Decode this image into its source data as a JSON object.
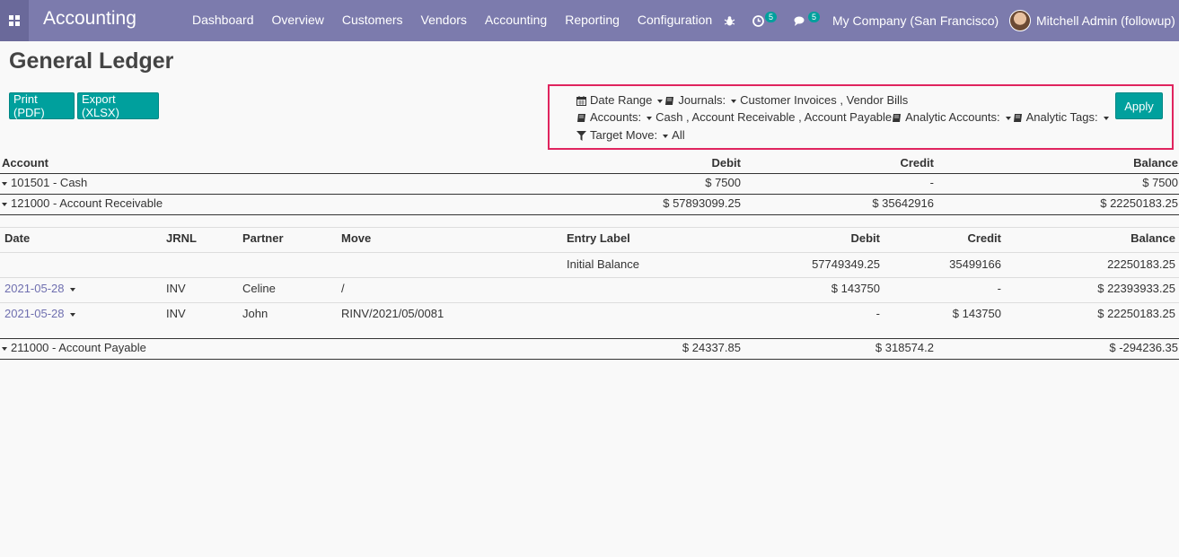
{
  "nav": {
    "app_name": "Accounting",
    "menu": [
      "Dashboard",
      "Overview",
      "Customers",
      "Vendors",
      "Accounting",
      "Reporting",
      "Configuration"
    ],
    "activity_count": "5",
    "message_count": "5",
    "company": "My Company (San Francisco)",
    "user": "Mitchell Admin (followup)"
  },
  "page": {
    "title": "General Ledger",
    "print_label": "Print (PDF)",
    "export_label": "Export (XLSX)",
    "apply_label": "Apply"
  },
  "filters": {
    "date_range_label": "Date Range",
    "journals_label": "Journals:",
    "journals_value": "Customer Invoices , Vendor Bills",
    "accounts_label": "Accounts:",
    "accounts_value": "Cash , Account Receivable , Account Payable",
    "analytic_accounts_label": "Analytic Accounts:",
    "analytic_tags_label": "Analytic Tags:",
    "target_move_label": "Target Move:",
    "target_move_value": "All"
  },
  "ledger": {
    "headers": {
      "account": "Account",
      "debit": "Debit",
      "credit": "Credit",
      "balance": "Balance"
    },
    "accounts": [
      {
        "name": "101501 - Cash",
        "debit": "$ 7500",
        "credit": "-",
        "balance": "$ 7500"
      },
      {
        "name": "121000 - Account Receivable",
        "debit": "$ 57893099.25",
        "credit": "$ 35642916",
        "balance": "$ 22250183.25"
      },
      {
        "name": "211000 - Account Payable",
        "debit": "$ 24337.85",
        "credit": "$ 318574.2",
        "balance": "$ -294236.35"
      }
    ],
    "detail_headers": {
      "date": "Date",
      "jrnl": "JRNL",
      "partner": "Partner",
      "move": "Move",
      "entry_label": "Entry Label",
      "debit": "Debit",
      "credit": "Credit",
      "balance": "Balance"
    },
    "initial": {
      "label": "Initial Balance",
      "debit": "57749349.25",
      "credit": "35499166",
      "balance": "22250183.25"
    },
    "lines": [
      {
        "date": "2021-05-28",
        "jrnl": "INV",
        "partner": "Celine",
        "move": "/",
        "entry_label": "",
        "debit": "$ 143750",
        "credit": "-",
        "balance": "$ 22393933.25"
      },
      {
        "date": "2021-05-28",
        "jrnl": "INV",
        "partner": "John",
        "move": "RINV/2021/05/0081",
        "entry_label": "",
        "debit": "-",
        "credit": "$ 143750",
        "balance": "$ 22250183.25"
      }
    ]
  }
}
